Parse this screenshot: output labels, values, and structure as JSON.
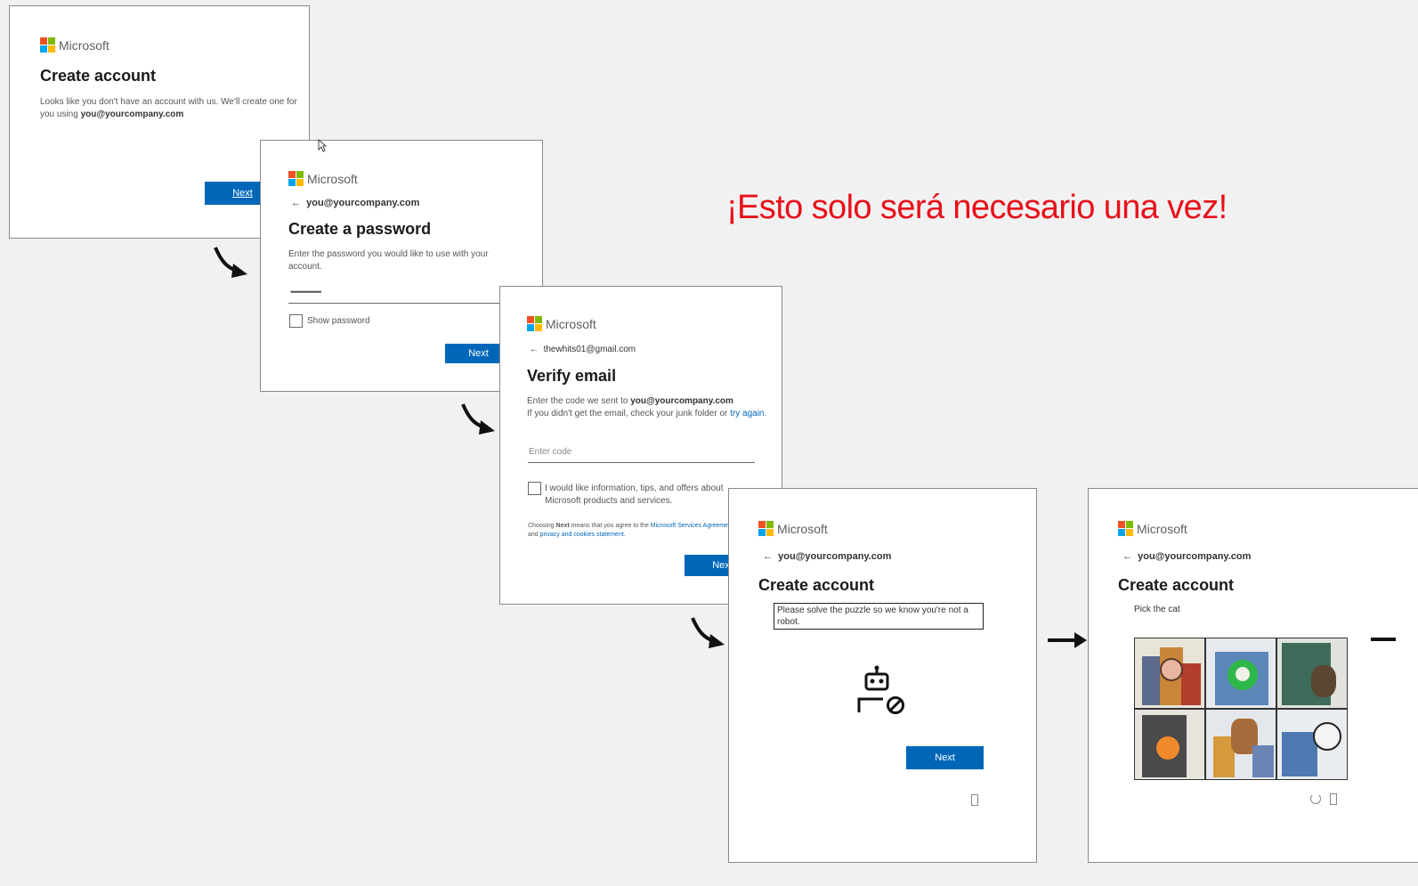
{
  "banner": "¡Esto solo será necesario una vez!",
  "brand": "Microsoft",
  "cards": {
    "create_account": {
      "title": "Create account",
      "text_pre": "Looks like you don't have an account with us. We'll create one for you using ",
      "email": "you@yourcompany.com",
      "next": "Next"
    },
    "create_password": {
      "back_email": "you@yourcompany.com",
      "title": "Create a password",
      "instructions": "Enter the password you would like to use with your account.",
      "password_value": "••••••••••••••••",
      "show_password": "Show password",
      "next": "Next"
    },
    "verify_email": {
      "back_email": "thewhits01@gmail.com",
      "title": "Verify email",
      "text_pre": "Enter the code we sent to ",
      "email": "you@yourcompany.com",
      "text_mid": "If you didn't get the email, check your junk folder or ",
      "try_again": "try again.",
      "placeholder": "Enter code",
      "offers": "I would like information, tips, and offers about Microsoft products and services.",
      "legal_pre": "Choosing ",
      "legal_next": "Next",
      "legal_mid": " means that you agree to the ",
      "legal_link1": "Microsoft Services Agreement",
      "legal_and": " and ",
      "legal_link2": "privacy and cookies statement.",
      "next": "Next"
    },
    "robot_check": {
      "back_email": "you@yourcompany.com",
      "title": "Create account",
      "puzzle_text": "Please solve the puzzle so we know you're not a robot.",
      "next": "Next"
    },
    "pick_cat": {
      "back_email": "you@yourcompany.com",
      "title": "Create account",
      "instruction": "Pick the cat"
    }
  },
  "icons": [
    "microsoft-logo",
    "back-arrow-icon",
    "robot-icon",
    "refresh-icon",
    "audio-icon",
    "flow-arrow-icon"
  ],
  "colors": {
    "brand_blue": "#0067b8",
    "banner_red": "#e8101a"
  }
}
